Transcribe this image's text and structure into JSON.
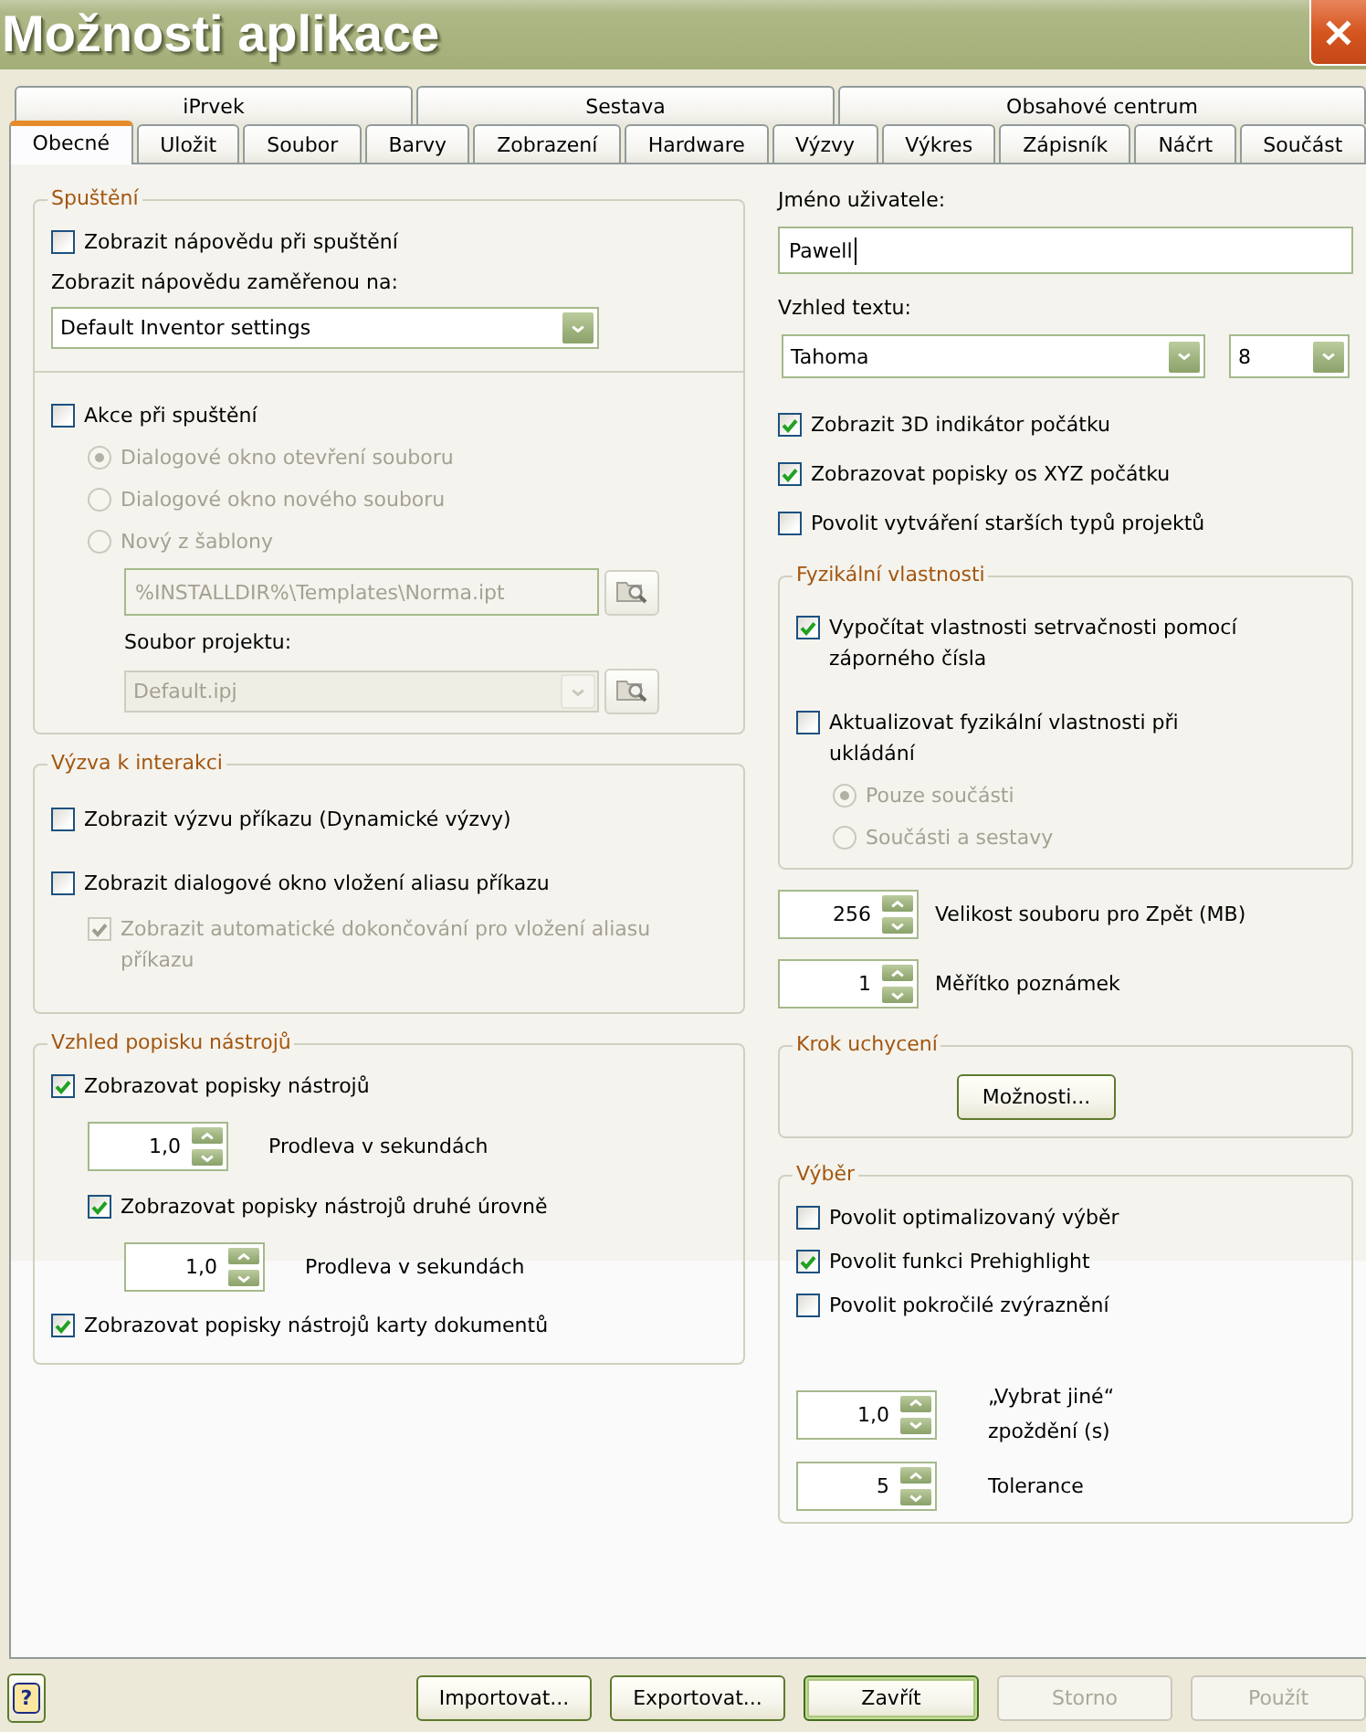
{
  "window": {
    "title": "Možnosti aplikace"
  },
  "tabs": {
    "upper": [
      {
        "label": "iPrvek",
        "selected": false
      },
      {
        "label": "Sestava",
        "selected": false
      },
      {
        "label": "Obsahové centrum",
        "selected": false
      }
    ],
    "lower": [
      {
        "label": "Obecné",
        "selected": true
      },
      {
        "label": "Uložit",
        "selected": false
      },
      {
        "label": "Soubor",
        "selected": false
      },
      {
        "label": "Barvy",
        "selected": false
      },
      {
        "label": "Zobrazení",
        "selected": false
      },
      {
        "label": "Hardware",
        "selected": false
      },
      {
        "label": "Výzvy",
        "selected": false
      },
      {
        "label": "Výkres",
        "selected": false
      },
      {
        "label": "Zápisník",
        "selected": false
      },
      {
        "label": "Náčrt",
        "selected": false
      },
      {
        "label": "Součást",
        "selected": false
      }
    ]
  },
  "left_column": [
    {
      "kind": "group",
      "title": "Spuštění",
      "sections": [
        [
          {
            "kind": "checkbox",
            "label": "Zobrazit nápovědu při spuštění",
            "checked": false,
            "disabled": false
          },
          {
            "kind": "label",
            "text": "Zobrazit nápovědu zaměřenou na:"
          },
          {
            "kind": "dropdown",
            "value": "Default Inventor settings",
            "disabled": false
          }
        ],
        [
          {
            "kind": "checkbox",
            "label": "Akce při spuštění",
            "checked": false,
            "disabled": false,
            "children": [
              {
                "kind": "radio",
                "label": "Dialogové okno otevření souboru",
                "selected": true,
                "disabled": true
              },
              {
                "kind": "radio",
                "label": "Dialogové okno nového souboru",
                "selected": false,
                "disabled": true
              },
              {
                "kind": "radio",
                "label": "Nový z šablony",
                "selected": false,
                "disabled": true,
                "children": [
                  {
                    "kind": "text_field",
                    "value": "%INSTALLDIR%\\Templates\\Norma.ipt",
                    "disabled": true,
                    "focused": false,
                    "browse": true
                  },
                  {
                    "kind": "label",
                    "text": "Soubor projektu:"
                  },
                  {
                    "kind": "dropdown",
                    "value": "Default.ipj",
                    "disabled": true,
                    "browse": true
                  }
                ]
              }
            ]
          }
        ]
      ]
    },
    {
      "kind": "group",
      "title": "Výzva k interakci",
      "sections": [
        [
          {
            "kind": "checkbox",
            "label": "Zobrazit výzvu příkazu (Dynamické výzvy)",
            "checked": false,
            "disabled": false
          },
          {
            "kind": "checkbox",
            "label": "Zobrazit dialogové okno vložení aliasu příkazu",
            "checked": false,
            "disabled": false,
            "children": [
              {
                "kind": "checkbox",
                "label": "Zobrazit automatické dokončování pro vložení aliasu příkazu",
                "checked": true,
                "disabled": true
              }
            ]
          }
        ]
      ]
    },
    {
      "kind": "group",
      "title": "Vzhled popisku nástrojů",
      "sections": [
        [
          {
            "kind": "checkbox",
            "label": "Zobrazovat popisky nástrojů",
            "checked": true,
            "disabled": false,
            "children": [
              {
                "kind": "spinner",
                "value": "1,0",
                "label": "Prodleva v sekundách"
              },
              {
                "kind": "checkbox",
                "label": "Zobrazovat popisky nástrojů druhé úrovně",
                "checked": true,
                "disabled": false,
                "children": [
                  {
                    "kind": "spinner",
                    "value": "1,0",
                    "label": "Prodleva v sekundách"
                  }
                ]
              }
            ]
          },
          {
            "kind": "checkbox",
            "label": "Zobrazovat popisky nástrojů karty dokumentů",
            "checked": true,
            "disabled": false
          }
        ]
      ]
    }
  ],
  "right_column": [
    {
      "kind": "label",
      "text": "Jméno uživatele:"
    },
    {
      "kind": "text_field",
      "value": "Pawell",
      "disabled": false,
      "focused": true
    },
    {
      "kind": "label",
      "text": "Vzhled textu:"
    },
    {
      "kind": "dropdown_row",
      "dropdowns": [
        {
          "value": "Tahoma",
          "disabled": false
        },
        {
          "value": "8",
          "disabled": false
        }
      ]
    },
    {
      "kind": "checkbox",
      "label": "Zobrazit 3D indikátor počátku",
      "checked": true,
      "disabled": false
    },
    {
      "kind": "checkbox",
      "label": "Zobrazovat popisky os XYZ počátku",
      "checked": true,
      "disabled": false
    },
    {
      "kind": "checkbox",
      "label": "Povolit vytváření starších typů projektů",
      "checked": false,
      "disabled": false
    },
    {
      "kind": "group",
      "title": "Fyzikální vlastnosti",
      "sections": [
        [
          {
            "kind": "checkbox",
            "label": "Vypočítat vlastnosti setrvačnosti pomocí záporného čísla",
            "checked": true,
            "disabled": false
          },
          {
            "kind": "checkbox",
            "label": "Aktualizovat fyzikální vlastnosti při ukládání",
            "checked": false,
            "disabled": false,
            "children": [
              {
                "kind": "radio",
                "label": "Pouze součásti",
                "selected": true,
                "disabled": true
              },
              {
                "kind": "radio",
                "label": "Součásti a sestavy",
                "selected": false,
                "disabled": true
              }
            ]
          }
        ]
      ]
    },
    {
      "kind": "spinner",
      "value": "256",
      "label": "Velikost souboru pro Zpět (MB)"
    },
    {
      "kind": "spinner",
      "value": "1",
      "label": "Měřítko poznámek"
    },
    {
      "kind": "group",
      "title": "Krok uchycení",
      "sections": [
        [
          {
            "kind": "button",
            "label": "Možnosti...",
            "disabled": false
          }
        ]
      ]
    },
    {
      "kind": "group",
      "title": "Výběr",
      "sections": [
        [
          {
            "kind": "checkbox",
            "label": "Povolit optimalizovaný výběr",
            "checked": false,
            "disabled": false
          },
          {
            "kind": "checkbox",
            "label": "Povolit funkci Prehighlight",
            "checked": true,
            "disabled": false
          },
          {
            "kind": "checkbox",
            "label": "Povolit pokročilé zvýraznění",
            "checked": false,
            "disabled": false
          },
          {
            "kind": "spinner",
            "value": "1,0",
            "label": "„Vybrat jiné“ zpoždění (s)"
          },
          {
            "kind": "spinner",
            "value": "5",
            "label": "Tolerance"
          }
        ]
      ]
    }
  ],
  "footer": {
    "help_button": {
      "label": "?"
    },
    "buttons": [
      {
        "label": "Importovat...",
        "disabled": false,
        "default": false
      },
      {
        "label": "Exportovat...",
        "disabled": false,
        "default": false
      },
      {
        "label": "Zavřít",
        "disabled": false,
        "default": true
      },
      {
        "label": "Storno",
        "disabled": true,
        "default": false
      },
      {
        "label": "Použít",
        "disabled": true,
        "default": false
      }
    ]
  }
}
